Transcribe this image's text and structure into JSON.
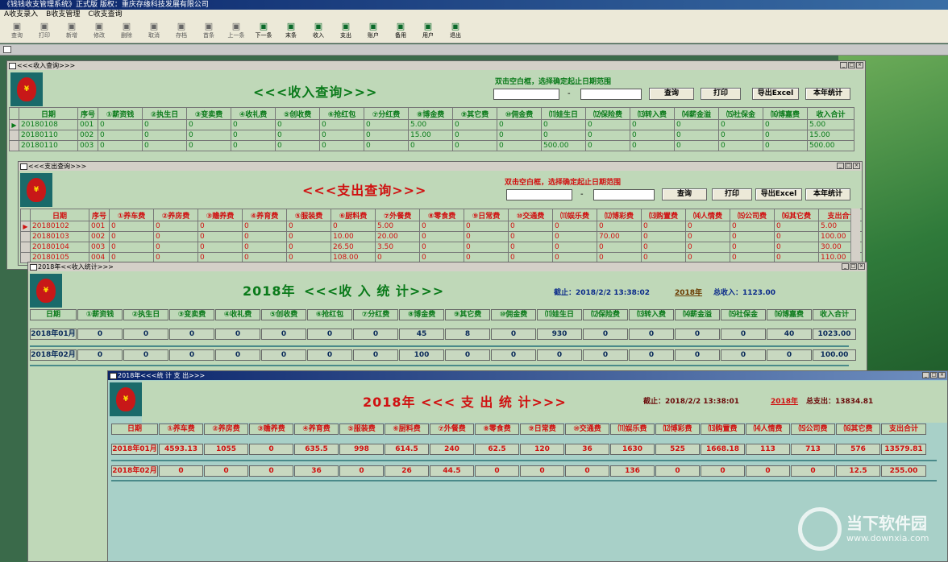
{
  "app": {
    "title": "《钱钱收支管理系统》正式版     版权：重庆存缘科技发展有限公司"
  },
  "menu": [
    "A收支录入",
    "B收支管理",
    "C收支查询"
  ],
  "toolbar": [
    {
      "label": "查询",
      "icon": "search-icon",
      "active": false
    },
    {
      "label": "打印",
      "icon": "print-icon",
      "active": false
    },
    {
      "label": "新增",
      "icon": "new-icon",
      "active": false
    },
    {
      "label": "修改",
      "icon": "edit-icon",
      "active": false
    },
    {
      "label": "删除",
      "icon": "delete-icon",
      "active": false
    },
    {
      "label": "取消",
      "icon": "cancel-icon",
      "active": false
    },
    {
      "label": "存档",
      "icon": "save-icon",
      "active": false
    },
    {
      "label": "首条",
      "icon": "first-icon",
      "active": false
    },
    {
      "label": "上一条",
      "icon": "prev-icon",
      "active": false
    },
    {
      "label": "下一条",
      "icon": "next-icon",
      "active": true
    },
    {
      "label": "末条",
      "icon": "last-icon",
      "active": true
    },
    {
      "label": "收入",
      "icon": "income-icon",
      "active": true
    },
    {
      "label": "支出",
      "icon": "expense-icon",
      "active": true
    },
    {
      "label": "账户",
      "icon": "account-icon",
      "active": true
    },
    {
      "label": "备用",
      "icon": "spare-icon",
      "active": true
    },
    {
      "label": "用户",
      "icon": "user-icon",
      "active": true
    },
    {
      "label": "退出",
      "icon": "exit-icon",
      "active": true
    }
  ],
  "w1": {
    "title": "<<<收入查询>>>",
    "heading": "<<<收入查询>>>",
    "note": "双击空白框，选择确定起止日期范围",
    "dash": "-",
    "buttons": [
      "查询",
      "打印",
      "导出Excel",
      "本年统计"
    ],
    "headers": [
      "日期",
      "序号",
      "①薪资钱",
      "②执生日",
      "③变卖费",
      "④收礼费",
      "⑤创收费",
      "⑥抢红包",
      "⑦分红费",
      "⑧博金费",
      "⑨其它费",
      "⑩佣金费",
      "⑾娃生日",
      "⑿保险费",
      "⒀转入费",
      "⒁薪金溢",
      "⒂社保金",
      "⒃博嘉费",
      "收入合计"
    ],
    "rows": [
      [
        "20180108",
        "001",
        "0",
        "0",
        "0",
        "0",
        "0",
        "0",
        "0",
        "5.00",
        "0",
        "0",
        "0",
        "0",
        "0",
        "0",
        "0",
        "0",
        "5.00"
      ],
      [
        "20180110",
        "002",
        "0",
        "0",
        "0",
        "0",
        "0",
        "0",
        "0",
        "15.00",
        "0",
        "0",
        "0",
        "0",
        "0",
        "0",
        "0",
        "0",
        "15.00"
      ],
      [
        "20180110",
        "003",
        "0",
        "0",
        "0",
        "0",
        "0",
        "0",
        "0",
        "0",
        "0",
        "0",
        "500.00",
        "0",
        "0",
        "0",
        "0",
        "0",
        "500.00"
      ]
    ]
  },
  "w2": {
    "title": "<<<支出查询>>>",
    "heading": "<<<支出查询>>>",
    "note": "双击空白框，选择确定起止日期范围",
    "dash": "-",
    "buttons": [
      "查询",
      "打印",
      "导出Excel",
      "本年统计"
    ],
    "headers": [
      "日期",
      "序号",
      "①养车费",
      "②养房费",
      "③赡养费",
      "④养育费",
      "⑤服装费",
      "⑥厨料费",
      "⑦外餐费",
      "⑧零食费",
      "⑨日常费",
      "⑩交通费",
      "⑾娱乐费",
      "⑿博彩费",
      "⒀购置费",
      "⒁人情费",
      "⒂公司费",
      "⒃其它费",
      "支出合计"
    ],
    "rows": [
      [
        "20180102",
        "001",
        "0",
        "0",
        "0",
        "0",
        "0",
        "0",
        "5.00",
        "0",
        "0",
        "0",
        "0",
        "0",
        "0",
        "0",
        "0",
        "0",
        "5.00"
      ],
      [
        "20180103",
        "002",
        "0",
        "0",
        "0",
        "0",
        "0",
        "10.00",
        "20.00",
        "0",
        "0",
        "0",
        "0",
        "70.00",
        "0",
        "0",
        "0",
        "0",
        "100.00"
      ],
      [
        "20180104",
        "003",
        "0",
        "0",
        "0",
        "0",
        "0",
        "26.50",
        "3.50",
        "0",
        "0",
        "0",
        "0",
        "0",
        "0",
        "0",
        "0",
        "0",
        "30.00"
      ],
      [
        "20180105",
        "004",
        "0",
        "0",
        "0",
        "0",
        "0",
        "108.00",
        "0",
        "0",
        "0",
        "0",
        "0",
        "0",
        "0",
        "0",
        "0",
        "0",
        "110.00"
      ]
    ]
  },
  "w3": {
    "title": "2018年<<收入统计>>>",
    "year": "2018年",
    "heading": "<<<收 入 统 计>>>",
    "deadline": "截止：2018/2/2   13:38:02",
    "yearlink": "2018年",
    "total": "总收入：1123.00",
    "headers": [
      "日期",
      "①薪资钱",
      "②执生日",
      "③变卖费",
      "④收礼费",
      "⑤创收费",
      "⑥抢红包",
      "⑦分红费",
      "⑧博金费",
      "⑨其它费",
      "⑩佣金费",
      "⑾娃生日",
      "⑿保险费",
      "⒀转入费",
      "⒁薪金溢",
      "⒂社保金",
      "⒃博嘉费",
      "收入合计"
    ],
    "rows": [
      [
        "2018年01月",
        "0",
        "0",
        "0",
        "0",
        "0",
        "0",
        "0",
        "45",
        "8",
        "0",
        "930",
        "0",
        "0",
        "0",
        "0",
        "40",
        "1023.00"
      ],
      [
        "2018年02月",
        "0",
        "0",
        "0",
        "0",
        "0",
        "0",
        "0",
        "100",
        "0",
        "0",
        "0",
        "0",
        "0",
        "0",
        "0",
        "0",
        "100.00"
      ]
    ]
  },
  "w4": {
    "title": "2018年<<<统 计 支 出>>>",
    "year": "2018年",
    "heading": "<<< 支 出 统 计>>>",
    "deadline": "截止：2018/2/2   13:38:01",
    "yearlink": "2018年",
    "total": "总支出：13834.81",
    "headers": [
      "日期",
      "①养车费",
      "②养房费",
      "③赡养费",
      "④养育费",
      "⑤服装费",
      "⑥厨料费",
      "⑦外餐费",
      "⑧零食费",
      "⑨日常费",
      "⑩交通费",
      "⑾娱乐费",
      "⑿博彩费",
      "⒀购置费",
      "⒁人情费",
      "⒂公司费",
      "⒃其它费",
      "支出合计"
    ],
    "rows": [
      [
        "2018年01月",
        "4593.13",
        "1055",
        "0",
        "635.5",
        "998",
        "614.5",
        "240",
        "62.5",
        "120",
        "36",
        "1630",
        "525",
        "1668.18",
        "113",
        "713",
        "576",
        "13579.81"
      ],
      [
        "2018年02月",
        "0",
        "0",
        "0",
        "36",
        "0",
        "26",
        "44.5",
        "0",
        "0",
        "0",
        "136",
        "0",
        "0",
        "0",
        "0",
        "12.5",
        "255.00"
      ]
    ]
  },
  "watermark": {
    "name": "当下软件园",
    "url": "www.downxia.com"
  },
  "colors": {
    "green": "#0a7a1a",
    "red": "#d01010",
    "blue": "#0a2a8a",
    "brown": "#6a3a00"
  }
}
